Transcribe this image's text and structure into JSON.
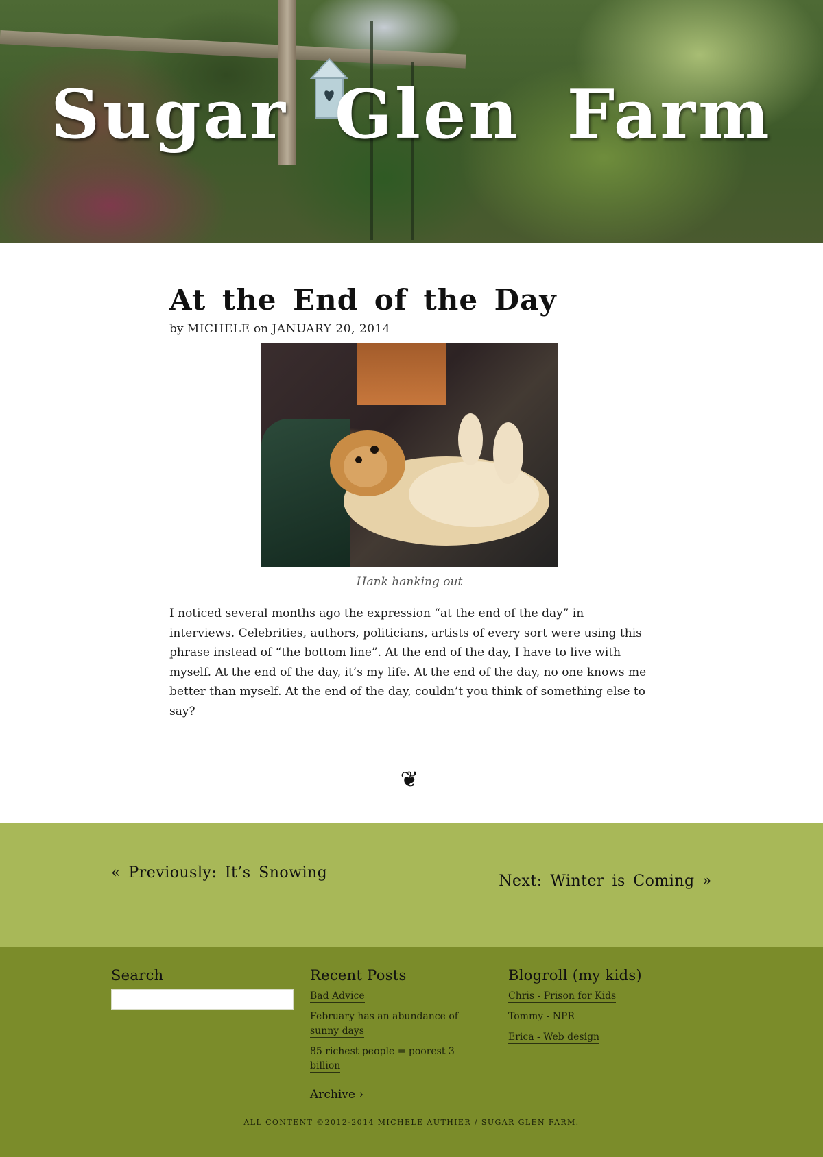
{
  "site": {
    "title": "Sugar Glen Farm"
  },
  "post": {
    "title": "At the End of the Day",
    "byline_prefix": "by",
    "author": "MICHELE",
    "byline_on": "on",
    "date": "JANUARY 20, 2014",
    "image_caption": "Hank hanking out",
    "body": "I noticed several months ago the expression “at the end of the day” in interviews. Celebrities, authors, politicians, artists of every sort were using this phrase instead of “the bottom line”. At the end of the day, I have to live with myself. At the end of the day, it’s my life. At the end of the day, no one knows me better than myself. At the end of the day, couldn’t you think of something else to say?",
    "ornament": "❦"
  },
  "post_nav": {
    "previous": "«  Previously:  It’s Snowing",
    "next": "Next:  Winter  is  Coming   »"
  },
  "footer": {
    "search": {
      "heading": "Search",
      "placeholder": ""
    },
    "recent_posts": {
      "heading": "Recent  Posts",
      "items": [
        "Bad Advice",
        "February has an abundance of sunny days",
        "85 richest people = poorest 3 billion"
      ],
      "archive_label": "Archive  ›"
    },
    "blogroll": {
      "heading": "Blogroll  (my  kids)",
      "items": [
        "Chris - Prison for Kids",
        "Tommy - NPR",
        "Erica - Web design"
      ]
    },
    "copyright": "ALL CONTENT ©2012-2014 MICHELE AUTHIER / SUGAR GLEN FARM."
  },
  "colors": {
    "nav_band": "#a8b858",
    "footer_band": "#7b8c2a",
    "title_text": "#ffffff"
  },
  "icons": {
    "ornament": "fleuron-heart-icon"
  }
}
